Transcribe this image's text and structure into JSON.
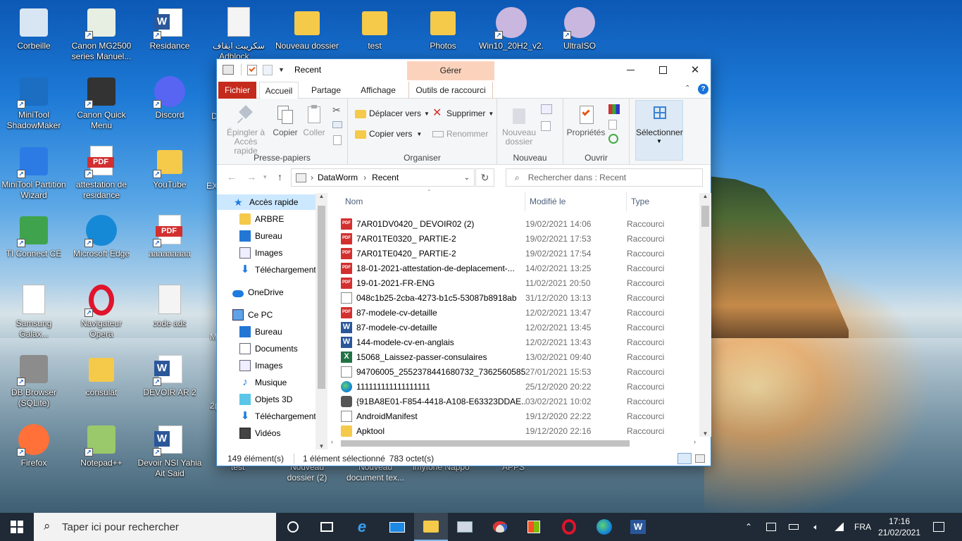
{
  "desktop": {
    "icons": [
      {
        "label": "Corbeille",
        "icon": "recycle-bin-icon"
      },
      {
        "label": "Canon MG2500 series Manuel...",
        "icon": "canon-manual-icon"
      },
      {
        "label": "Residance",
        "icon": "word-doc-icon"
      },
      {
        "label": "سكريبت ايقاف Adblock ...",
        "icon": "text-file-icon"
      },
      {
        "label": "Nouveau dossier",
        "icon": "folder-icon"
      },
      {
        "label": "test",
        "icon": "folder-icon"
      },
      {
        "label": "Photos",
        "icon": "photo-folder-icon"
      },
      {
        "label": "Win10_20H2_v2...",
        "icon": "disc-image-icon"
      },
      {
        "label": "UltraISO",
        "icon": "disc-image-icon"
      },
      {
        "label": "MiniTool ShadowMaker",
        "icon": "minitool-shadowmaker-icon"
      },
      {
        "label": "Canon Quick Menu",
        "icon": "canon-quick-menu-icon"
      },
      {
        "label": "Discord",
        "icon": "discord-icon"
      },
      {
        "label": "MiniTool Partition Wizard",
        "icon": "minitool-partition-icon"
      },
      {
        "label": "attestation de residance",
        "icon": "pdf-icon"
      },
      {
        "label": "YouTube",
        "icon": "youtube-file-icon"
      },
      {
        "label": "TI Connect CE",
        "icon": "ti-connect-icon"
      },
      {
        "label": "Microsoft Edge",
        "icon": "edge-icon"
      },
      {
        "label": "aaaaaaaaa",
        "icon": "pdf-icon"
      },
      {
        "label": "Samsung Galax...",
        "icon": "samsung-icon"
      },
      {
        "label": "Navigateur Opera",
        "icon": "opera-icon"
      },
      {
        "label": "code ads",
        "icon": "text-file-icon"
      },
      {
        "label": "DB Browser (SQLite)",
        "icon": "db-browser-icon"
      },
      {
        "label": "consulat",
        "icon": "folder-icon"
      },
      {
        "label": "DEVOIR AR 2",
        "icon": "word-doc-icon"
      },
      {
        "label": "Firefox",
        "icon": "firefox-icon"
      },
      {
        "label": "Notepad++",
        "icon": "notepad-plus-icon"
      },
      {
        "label": "Devoir NSI Yahia Ait Said",
        "icon": "word-doc-icon"
      }
    ],
    "partial_labels": [
      "D",
      "EX",
      "M",
      "2(",
      "test",
      "Nouveau dossier (2)",
      "Nouveau document tex...",
      "imyfone Nappo",
      "APPS"
    ]
  },
  "window": {
    "title": "Recent",
    "contextual_tab_group": "Gérer",
    "tabs": [
      "Fichier",
      "Accueil",
      "Partage",
      "Affichage",
      "Outils de raccourci"
    ],
    "ribbon": {
      "clipboard": {
        "name": "Presse-papiers",
        "pin": "Épingler à Accès rapide",
        "copy": "Copier",
        "paste": "Coller"
      },
      "organize": {
        "name": "Organiser",
        "move": "Déplacer vers",
        "copy_to": "Copier vers",
        "delete": "Supprimer",
        "rename": "Renommer"
      },
      "new": {
        "name": "Nouveau",
        "new_folder": "Nouveau dossier"
      },
      "open": {
        "name": "Ouvrir",
        "properties": "Propriétés"
      },
      "select": {
        "label": "Sélectionner"
      }
    },
    "address": {
      "root": "DataWorm",
      "current": "Recent",
      "search_placeholder": "Rechercher dans : Recent"
    },
    "nav": [
      {
        "label": "Accès rapide",
        "type": "star"
      },
      {
        "label": "ARBRE",
        "type": "folder"
      },
      {
        "label": "Bureau",
        "type": "desktop"
      },
      {
        "label": "Images",
        "type": "images"
      },
      {
        "label": "Téléchargements",
        "type": "download"
      },
      {
        "label": "OneDrive",
        "type": "cloud"
      },
      {
        "label": "Ce PC",
        "type": "pc"
      },
      {
        "label": "Bureau",
        "type": "desktop"
      },
      {
        "label": "Documents",
        "type": "documents"
      },
      {
        "label": "Images",
        "type": "images"
      },
      {
        "label": "Musique",
        "type": "music"
      },
      {
        "label": "Objets 3D",
        "type": "objects3d"
      },
      {
        "label": "Téléchargements",
        "type": "download"
      },
      {
        "label": "Vidéos",
        "type": "videos"
      }
    ],
    "columns": [
      "Nom",
      "Modifié le",
      "Type"
    ],
    "files": [
      {
        "name": "7AR01DV0420_ DEVOIR02 (2)",
        "date": "19/02/2021 14:06",
        "type": "Raccourci",
        "kind": "pdf"
      },
      {
        "name": "7AR01TE0320_ PARTIE-2",
        "date": "19/02/2021 17:53",
        "type": "Raccourci",
        "kind": "pdf"
      },
      {
        "name": "7AR01TE0420_ PARTIE-2",
        "date": "19/02/2021 17:54",
        "type": "Raccourci",
        "kind": "pdf"
      },
      {
        "name": "18-01-2021-attestation-de-deplacement-...",
        "date": "14/02/2021 13:25",
        "type": "Raccourci",
        "kind": "pdf"
      },
      {
        "name": "19-01-2021-FR-ENG",
        "date": "11/02/2021 20:50",
        "type": "Raccourci",
        "kind": "pdf"
      },
      {
        "name": "048c1b25-2cba-4273-b1c5-53087b8918ab",
        "date": "31/12/2020 13:13",
        "type": "Raccourci",
        "kind": "doc"
      },
      {
        "name": "87-modele-cv-detaille",
        "date": "12/02/2021 13:47",
        "type": "Raccourci",
        "kind": "pdf"
      },
      {
        "name": "87-modele-cv-detaille",
        "date": "12/02/2021 13:45",
        "type": "Raccourci",
        "kind": "word"
      },
      {
        "name": "144-modele-cv-en-anglais",
        "date": "12/02/2021 13:43",
        "type": "Raccourci",
        "kind": "word"
      },
      {
        "name": "15068_Laissez-passer-consulaires",
        "date": "13/02/2021 09:40",
        "type": "Raccourci",
        "kind": "xls"
      },
      {
        "name": "94706005_2552378441680732_7362560585...",
        "date": "27/01/2021 15:53",
        "type": "Raccourci",
        "kind": "doc"
      },
      {
        "name": "111111111111111111",
        "date": "25/12/2020 20:22",
        "type": "Raccourci",
        "kind": "edge"
      },
      {
        "name": "{91BA8E01-F854-4418-A108-E63323DDAE...",
        "date": "03/02/2021 10:02",
        "type": "Raccourci",
        "kind": "cam"
      },
      {
        "name": "AndroidManifest",
        "date": "19/12/2020 22:22",
        "type": "Raccourci",
        "kind": "doc"
      },
      {
        "name": "Apktool",
        "date": "19/12/2020 22:16",
        "type": "Raccourci",
        "kind": "folder"
      }
    ],
    "status": {
      "count": "149 élément(s)",
      "selected": "1 élément sélectionné",
      "size": "783 octet(s)"
    }
  },
  "taskbar": {
    "search_placeholder": "Taper ici pour rechercher",
    "language": "FRA",
    "time": "17:16",
    "date": "21/02/2021"
  }
}
